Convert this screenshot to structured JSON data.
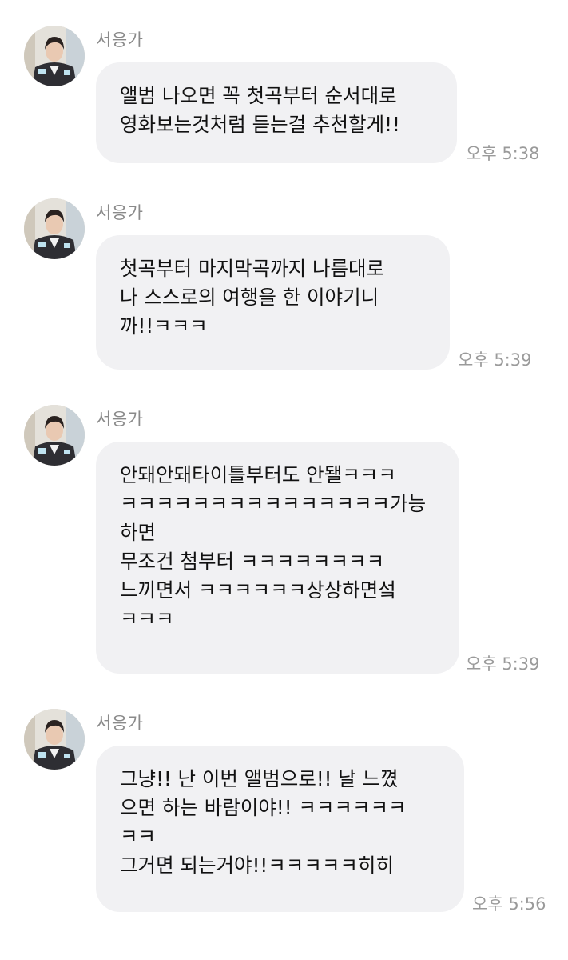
{
  "messages": [
    {
      "sender": "서응가",
      "avatar_icon": "profile-photo-icon",
      "text": "앨범 나오면 꼭 첫곡부터 순서대로\n영화보는것처럼 듣는걸 추천할게!!",
      "time": "오후 5:38"
    },
    {
      "sender": "서응가",
      "avatar_icon": "profile-photo-icon",
      "text": "첫곡부터 마지막곡까지 나름대로\n나 스스로의 여행을 한 이야기니\n까!!ㅋㅋㅋ",
      "time": "오후 5:39"
    },
    {
      "sender": "서응가",
      "avatar_icon": "profile-photo-icon",
      "text": "안돼안돼타이틀부터도 안됄ㅋㅋㅋ\nㅋㅋㅋㅋㅋㅋㅋㅋㅋㅋㅋㅋㅋㅋㅋ가능\n하면\n무조건 첨부터 ㅋㅋㅋㅋㅋㅋㅋㅋ\n느끼면서 ㅋㅋㅋㅋㅋㅋ상상하면섴\nㅋㅋㅋ",
      "time": "오후 5:39"
    },
    {
      "sender": "서응가",
      "avatar_icon": "profile-photo-icon",
      "text": "그냥!! 난 이번 앨범으로!! 날 느꼈\n으면 하는 바람이야!! ㅋㅋㅋㅋㅋㅋ\nㅋㅋ\n그거면 되는거야!!ㅋㅋㅋㅋㅋ히히",
      "time": "오후 5:56"
    }
  ],
  "colors": {
    "bubble": "#f1f1f3",
    "text": "#111111",
    "meta": "#9a9a9a"
  }
}
